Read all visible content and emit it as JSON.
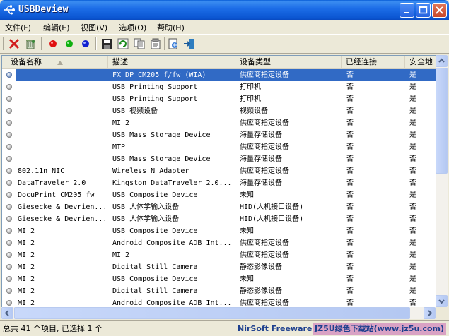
{
  "window": {
    "title": "USBDeview"
  },
  "menu": [
    "文件(F)",
    "编辑(E)",
    "视图(V)",
    "选项(O)",
    "帮助(H)"
  ],
  "toolbar_icons": [
    "delete-icon",
    "uninstall-icon",
    "red-circle-icon",
    "green-circle-icon",
    "blue-circle-icon",
    "save-icon",
    "refresh-icon",
    "copy-icon",
    "properties-icon",
    "html-report-icon",
    "exit-icon"
  ],
  "columns": [
    "设备名称",
    "描述",
    "设备类型",
    "已经连接",
    "安全地"
  ],
  "rows": [
    {
      "name": "",
      "desc": "FX DP CM205 f/fw (WIA)",
      "type": "供应商指定设备",
      "connected": "否",
      "safe": "是",
      "selected": true
    },
    {
      "name": "",
      "desc": "USB Printing Support",
      "type": "打印机",
      "connected": "否",
      "safe": "是"
    },
    {
      "name": "",
      "desc": "USB Printing Support",
      "type": "打印机",
      "connected": "否",
      "safe": "是"
    },
    {
      "name": "",
      "desc": "USB 视频设备",
      "type": "视频设备",
      "connected": "否",
      "safe": "是"
    },
    {
      "name": "",
      "desc": "MI 2",
      "type": "供应商指定设备",
      "connected": "否",
      "safe": "是"
    },
    {
      "name": "",
      "desc": "USB Mass Storage Device",
      "type": "海量存储设备",
      "connected": "否",
      "safe": "是"
    },
    {
      "name": "",
      "desc": "MTP",
      "type": "供应商指定设备",
      "connected": "否",
      "safe": "是"
    },
    {
      "name": "",
      "desc": "USB Mass Storage Device",
      "type": "海量存储设备",
      "connected": "否",
      "safe": "否"
    },
    {
      "name": "802.11n NIC",
      "desc": "Wireless N Adapter",
      "type": "供应商指定设备",
      "connected": "否",
      "safe": "否"
    },
    {
      "name": "DataTraveler 2.0",
      "desc": "Kingston DataTraveler 2.0...",
      "type": "海量存储设备",
      "connected": "否",
      "safe": "否"
    },
    {
      "name": "DocuPrint CM205 fw",
      "desc": "USB Composite Device",
      "type": "未知",
      "connected": "否",
      "safe": "是"
    },
    {
      "name": "Giesecke & Devrien...",
      "desc": "USB 人体学输入设备",
      "type": "HID(人机接口设备)",
      "connected": "否",
      "safe": "否"
    },
    {
      "name": "Giesecke & Devrien...",
      "desc": "USB 人体学输入设备",
      "type": "HID(人机接口设备)",
      "connected": "否",
      "safe": "否"
    },
    {
      "name": "MI 2",
      "desc": "USB Composite Device",
      "type": "未知",
      "connected": "否",
      "safe": "否"
    },
    {
      "name": "MI 2",
      "desc": "Android Composite ADB Int...",
      "type": "供应商指定设备",
      "connected": "否",
      "safe": "是"
    },
    {
      "name": "MI 2",
      "desc": "MI 2",
      "type": "供应商指定设备",
      "connected": "否",
      "safe": "是"
    },
    {
      "name": "MI 2",
      "desc": "Digital Still Camera",
      "type": "静态影像设备",
      "connected": "否",
      "safe": "是"
    },
    {
      "name": "MI 2",
      "desc": "USB Composite Device",
      "type": "未知",
      "connected": "否",
      "safe": "是"
    },
    {
      "name": "MI 2",
      "desc": "Digital Still Camera",
      "type": "静态影像设备",
      "connected": "否",
      "safe": "是"
    },
    {
      "name": "MI 2",
      "desc": "Android Composite ADB Int...",
      "type": "供应商指定设备",
      "connected": "否",
      "safe": "否"
    }
  ],
  "status": {
    "count": "总共 41 个项目, 已选择 1 个",
    "nirsoft": "NirSoft Freeware.  http://",
    "watermark": "JZ5U绿色下载站(www.jz5u.com)"
  }
}
